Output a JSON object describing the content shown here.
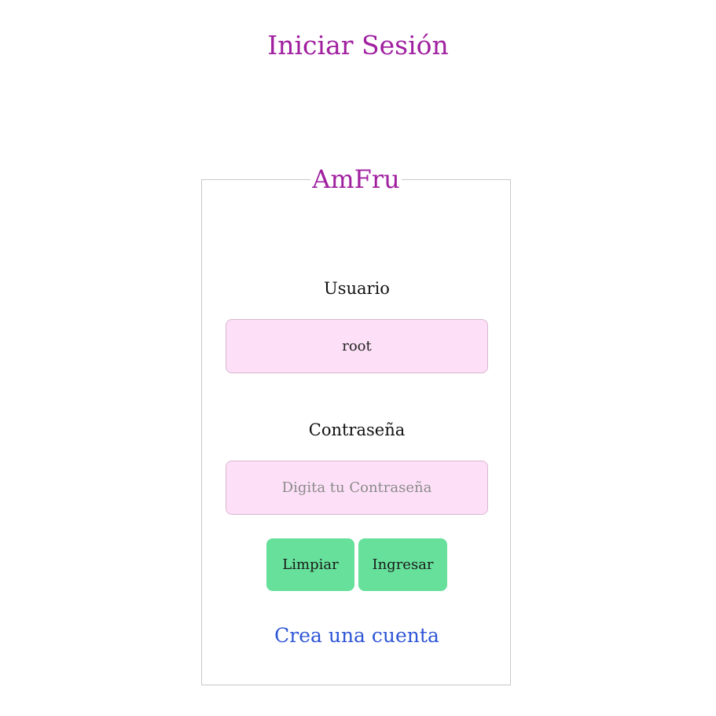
{
  "page": {
    "title": "Iniciar Sesión"
  },
  "form": {
    "legend": "AmFru",
    "username_label": "Usuario",
    "username_value": "root",
    "password_label": "Contraseña",
    "password_value": "",
    "password_placeholder": "Digita tu Contraseña",
    "clear_button_label": "Limpiar",
    "submit_button_label": "Ingresar",
    "create_account_link": "Crea una cuenta"
  },
  "colors": {
    "title": "#a020a0",
    "input_background": "#fde0f7",
    "button_background": "#66e09a",
    "link": "#2f56d6"
  }
}
